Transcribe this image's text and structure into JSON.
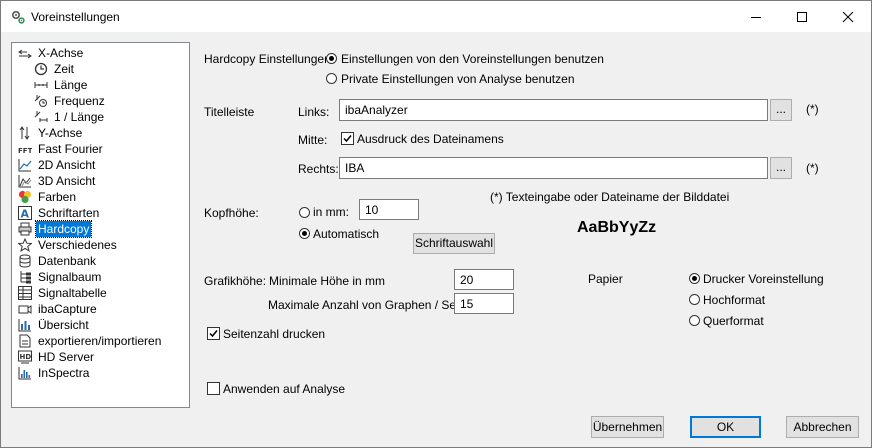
{
  "window": {
    "title": "Voreinstellungen",
    "icon": "gears-icon"
  },
  "tree": {
    "items": [
      {
        "label": "X-Achse",
        "icon": "x-axis-icon"
      },
      {
        "label": "Zeit",
        "icon": "clock-icon"
      },
      {
        "label": "Länge",
        "icon": "length-icon"
      },
      {
        "label": "Frequenz",
        "icon": "frequency-icon"
      },
      {
        "label": "1 / Länge",
        "icon": "inverse-length-icon"
      },
      {
        "label": "Y-Achse",
        "icon": "y-axis-icon"
      },
      {
        "label": "Fast Fourier",
        "icon": "fft-icon"
      },
      {
        "label": "2D Ansicht",
        "icon": "2d-view-icon"
      },
      {
        "label": "3D Ansicht",
        "icon": "3d-view-icon"
      },
      {
        "label": "Farben",
        "icon": "colors-icon"
      },
      {
        "label": "Schriftarten",
        "icon": "font-icon"
      },
      {
        "label": "Hardcopy",
        "icon": "printer-icon"
      },
      {
        "label": "Verschiedenes",
        "icon": "star-icon"
      },
      {
        "label": "Datenbank",
        "icon": "database-icon"
      },
      {
        "label": "Signalbaum",
        "icon": "signal-tree-icon"
      },
      {
        "label": "Signaltabelle",
        "icon": "signal-table-icon"
      },
      {
        "label": "ibaCapture",
        "icon": "camera-icon"
      },
      {
        "label": "Übersicht",
        "icon": "overview-icon"
      },
      {
        "label": "exportieren/importieren",
        "icon": "export-import-icon"
      },
      {
        "label": "HD Server",
        "icon": "hd-server-icon"
      },
      {
        "label": "InSpectra",
        "icon": "inspectra-icon"
      }
    ],
    "selected": "Hardcopy"
  },
  "hardcopy": {
    "label": "Hardcopy Einstellungen:",
    "option_defaults": "Einstellungen von den Voreinstellungen benutzen",
    "option_private": "Private Einstellungen von Analyse benutzen"
  },
  "titlebar_section": {
    "label": "Titelleiste",
    "links_label": "Links:",
    "links_value": "ibaAnalyzer",
    "mitte_label": "Mitte:",
    "mitte_check_label": "Ausdruck des Dateinamens",
    "rechts_label": "Rechts:",
    "rechts_value": "IBA",
    "browse_label": "...",
    "asterisk": "(*)",
    "note": "(*) Texteingabe oder Dateiname der Bilddatei"
  },
  "kopfhoehe": {
    "label": "Kopfhöhe:",
    "in_mm_label": "in mm:",
    "in_mm_value": "10",
    "auto_label": "Automatisch",
    "font_button": "Schriftauswahl",
    "font_sample": "AaBbYyZz"
  },
  "grafikhoehe": {
    "label": "Grafikhöhe:",
    "min_label": "Minimale Höhe in mm",
    "min_value": "20",
    "max_label": "Maximale Anzahl von Graphen / Seite",
    "max_value": "15"
  },
  "papier": {
    "label": "Papier",
    "options": [
      "Drucker Voreinstellung",
      "Hochformat",
      "Querformat"
    ]
  },
  "seitenzahl_label": "Seitenzahl drucken",
  "anwenden_label": "Anwenden auf Analyse",
  "buttons": {
    "apply": "Übernehmen",
    "ok": "OK",
    "cancel": "Abbrechen"
  }
}
